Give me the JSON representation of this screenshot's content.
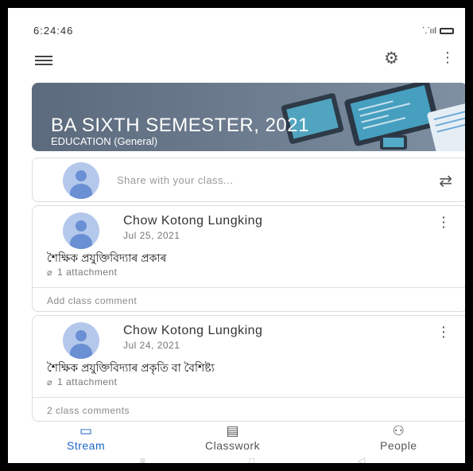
{
  "status_bar": {
    "time": "6:24:46",
    "signal": "⸪ııl"
  },
  "app_bar": {
    "menu_icon": "hamburger-icon",
    "settings_icon": "gear-icon",
    "more_icon": "kebab-icon"
  },
  "banner": {
    "title": "BA SIXTH SEMESTER, 2021",
    "subtitle": "EDUCATION (General)",
    "colors": {
      "base": "#6b7a8d",
      "accent": "#5ec8e8"
    }
  },
  "share": {
    "placeholder": "Share with your class...",
    "repost_icon": "repost-icon"
  },
  "posts": [
    {
      "author": "Chow Kotong Lungking",
      "date": "Jul 25, 2021",
      "title": "শৈক্ষিক প্ৰযুক্তিবিদ্যাৰ প্ৰকাৰ",
      "attachment": "1 attachment",
      "comment": "Add class comment"
    },
    {
      "author": "Chow Kotong Lungking",
      "date": "Jul 24, 2021",
      "title": "শৈক্ষিক প্ৰযুক্তিবিদ্যাৰ প্ৰকৃতি বা বৈশিষ্ট্য",
      "attachment": "1 attachment",
      "comment": "2 class comments"
    }
  ],
  "bottom_nav": {
    "items": [
      {
        "label": "Stream",
        "icon": "stream-icon",
        "active": true
      },
      {
        "label": "Classwork",
        "icon": "classwork-icon",
        "active": false
      },
      {
        "label": "People",
        "icon": "people-icon",
        "active": false
      }
    ],
    "active_color": "#1a63c4"
  },
  "system_nav": {
    "recents": "≡",
    "home": "□",
    "back": "◁"
  }
}
